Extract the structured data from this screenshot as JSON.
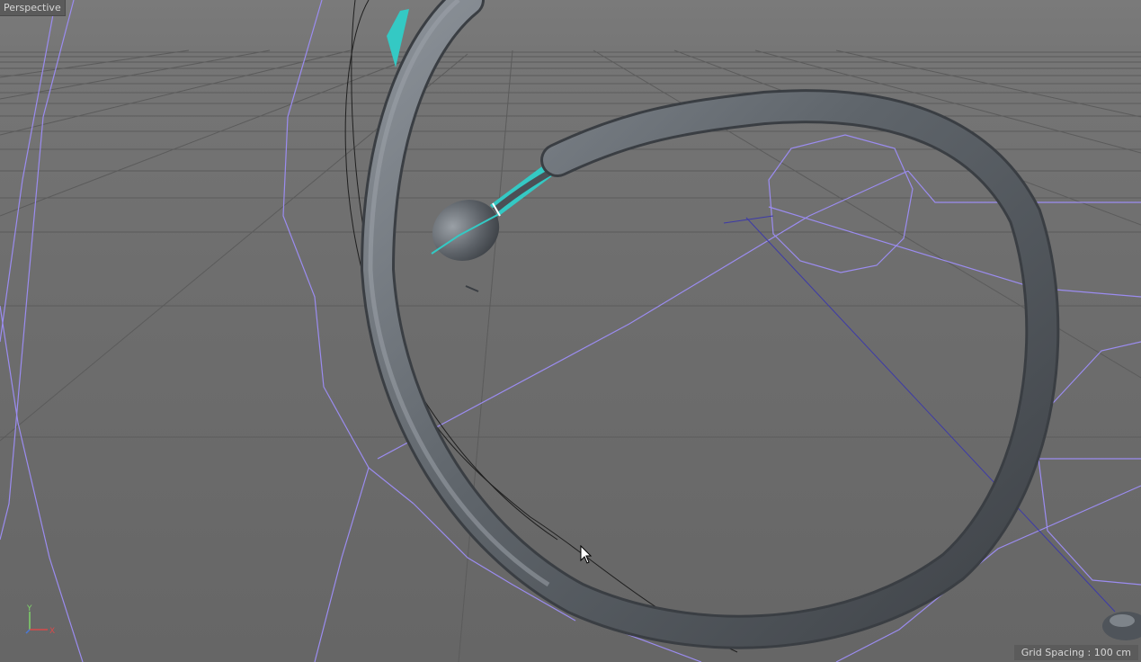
{
  "viewport": {
    "view_name": "Perspective",
    "grid_spacing_label": "Grid Spacing : 100 cm"
  },
  "axis_gizmo": {
    "x_label": "X",
    "y_label": "Y",
    "x_color": "#d94a4a",
    "y_color": "#7fd46a",
    "z_color": "#4a7ad9"
  },
  "colors": {
    "background": "#6f6f6f",
    "grid_line": "#5a5a5a",
    "wireframe": "#9b8cf0",
    "wire_dark": "#3d3aa8",
    "tube": "#5d6268",
    "highlight": "#34c9c4"
  },
  "icons": {
    "cursor": "arrow-cursor-icon",
    "axis": "axis-gizmo-icon"
  }
}
